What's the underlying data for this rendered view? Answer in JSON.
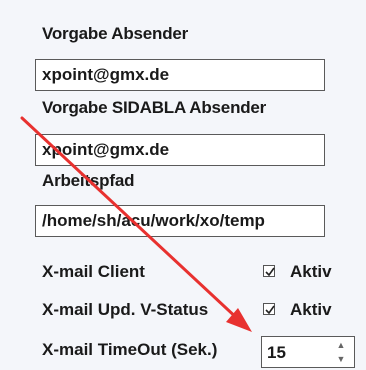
{
  "settings": {
    "sender_default_label": "Vorgabe Absender",
    "sender_default_value": "xpoint@gmx.de",
    "sidabla_sender_label": "Vorgabe SIDABLA Absender",
    "sidabla_sender_value": "xpoint@gmx.de",
    "workpath_label": "Arbeitspfad",
    "workpath_value": "/home/sh/acu/work/xo/temp",
    "xmail_client_label": "X-mail Client",
    "xmail_client_checkbox_label": "Aktiv",
    "xmail_client_checked": true,
    "xmail_upd_label": "X-mail Upd. V-Status",
    "xmail_upd_checkbox_label": "Aktiv",
    "xmail_upd_checked": true,
    "timeout_label": "X-mail TimeOut (Sek.)",
    "timeout_value": "15"
  },
  "annotation": {
    "arrow_color": "#e8312f"
  },
  "icons": [
    "checkmark-icon",
    "spin-up-icon",
    "spin-down-icon",
    "red-arrow-annotation"
  ]
}
